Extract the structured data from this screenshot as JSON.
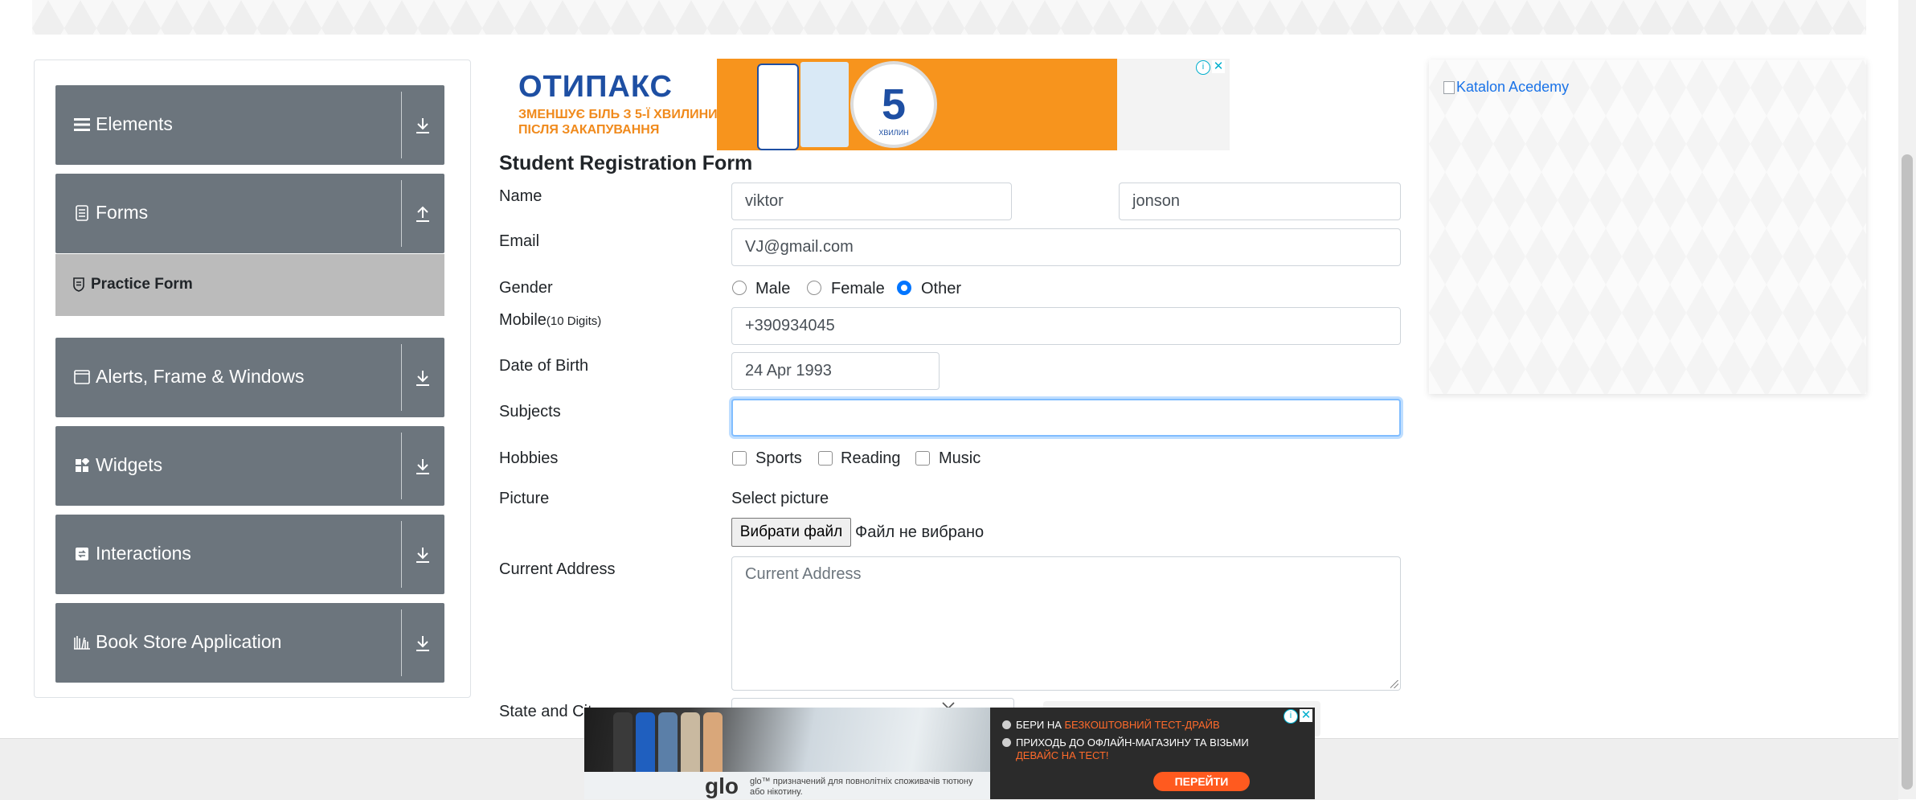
{
  "sidebar": {
    "groups": [
      {
        "label": "Elements",
        "icon": "hamburger-icon"
      },
      {
        "label": "Forms",
        "icon": "document-icon"
      },
      {
        "label": "Alerts, Frame & Windows",
        "icon": "window-icon"
      },
      {
        "label": "Widgets",
        "icon": "widgets-icon"
      },
      {
        "label": "Interactions",
        "icon": "interactions-icon"
      },
      {
        "label": "Book Store Application",
        "icon": "books-icon"
      }
    ],
    "active_item": {
      "label": "Practice Form",
      "icon": "shield-icon"
    }
  },
  "ad_top": {
    "brand": "ОТИПАКС",
    "tagline": "ЗМЕНШУЄ БІЛЬ З 5-Ї ХВИЛИНИ ПІСЛЯ ЗАКАПУВАННЯ",
    "clock_number": "5",
    "clock_caption": "ХВИЛИН"
  },
  "form": {
    "title": "Student Registration Form",
    "name_label": "Name",
    "first_name": "viktor",
    "last_name": "jonson",
    "email_label": "Email",
    "email": "VJ@gmail.com",
    "gender_label": "Gender",
    "gender_options": [
      "Male",
      "Female",
      "Other"
    ],
    "gender_selected": "Other",
    "mobile_label": "Mobile",
    "mobile_hint": "(10 Digits)",
    "mobile": "+390934045",
    "dob_label": "Date of Birth",
    "dob": "24 Apr 1993",
    "subjects_label": "Subjects",
    "subjects": "",
    "hobbies_label": "Hobbies",
    "hobbies": [
      "Sports",
      "Reading",
      "Music"
    ],
    "picture_label": "Picture",
    "select_picture": "Select picture",
    "file_button": "Вибрати файл",
    "file_status": "Файл не вибрано",
    "address_label": "Current Address",
    "address_placeholder": "Current Address",
    "state_label": "State and City"
  },
  "right_panel": {
    "image_alt": "Katalon Acedemy"
  },
  "ad_bottom": {
    "line1_prefix": "БЕРИ НА ",
    "line1_highlight": "БЕЗКОШТОВНИЙ ТЕСТ-ДРАЙВ",
    "line2": "ПРИХОДЬ ДО ОФЛАЙН-МАГАЗИНУ ТА ВІЗЬМИ",
    "line3_highlight": "ДЕВАЙС НА ТЕСТ!",
    "cta": "ПЕРЕЙТИ",
    "logo": "glo",
    "legal": "glo™ призначений для повнолітніх споживачів тютюну або нікотину."
  },
  "colors": {
    "sidebar_group": "#6c757d",
    "sidebar_active": "#bbbbbb",
    "radio_checked": "#0075ff",
    "focus_border": "#80bdff",
    "ad_orange": "#f7941d",
    "ad_cta": "#ff5a1f"
  }
}
